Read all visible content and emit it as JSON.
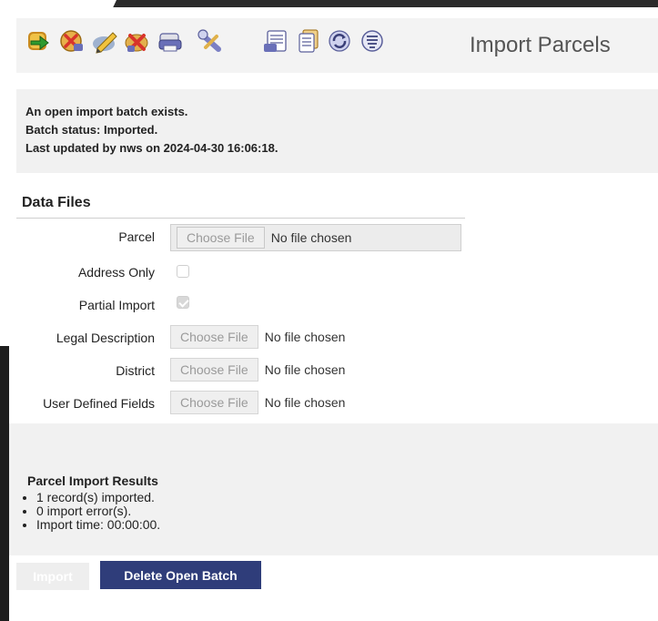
{
  "page": {
    "title": "Import Parcels"
  },
  "toolbar": {
    "icons": [
      "import-arrow-icon",
      "cancel-import-icon",
      "edit-pencil-icon",
      "delete-x-icon",
      "print-icon",
      "tools-icon",
      "report-icon",
      "documents-icon",
      "refresh-icon",
      "filter-list-icon"
    ]
  },
  "status": {
    "line1": "An open import batch exists.",
    "line2": "Batch status: Imported.",
    "line3": "Last updated by nws on 2024-04-30 16:06:18."
  },
  "data_files": {
    "heading": "Data Files",
    "parcel_label": "Parcel",
    "address_only_label": "Address Only",
    "address_only_checked": false,
    "partial_import_label": "Partial Import",
    "partial_import_checked": true,
    "legal_description_label": "Legal Description",
    "district_label": "District",
    "user_defined_fields_label": "User Defined Fields",
    "choose_file_label": "Choose File",
    "no_file_text": "No file chosen"
  },
  "results": {
    "heading": "Parcel Import Results",
    "items": [
      "1 record(s) imported.",
      "0 import error(s).",
      "Import time: 00:00:00."
    ]
  },
  "actions": {
    "import_label": "Import",
    "delete_label": "Delete Open Batch"
  },
  "colors": {
    "delete_button": "#2f3d7a",
    "panel_bg": "#f1f1f1"
  }
}
